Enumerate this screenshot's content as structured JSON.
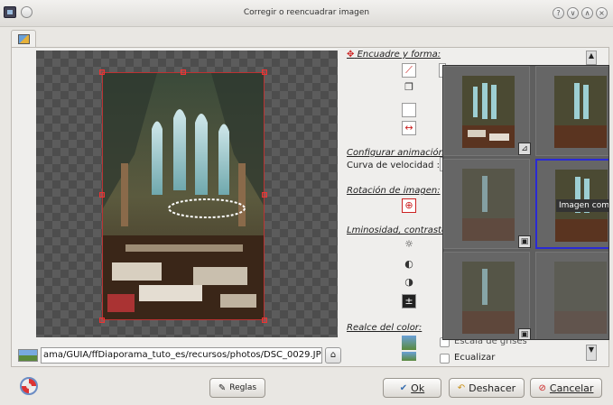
{
  "window": {
    "title": "Corregir o reencuadrar imagen",
    "controls": [
      "?",
      "∨",
      "∧",
      "×"
    ]
  },
  "editor": {
    "file_path": "ama/GUIA/ffDiaporama_tuto_es/recursos/photos/DSC_0029.JPG",
    "open_icon": "folder-open-icon"
  },
  "panel": {
    "sections": {
      "framing": "Encuadre y forma:",
      "animation": "Configurar animación:",
      "speed_curve": "Curva de velocidad :",
      "rotation": "Rotación de imagen:",
      "luminosity": "Lminosidad, contraste",
      "color": "Realce del color:"
    },
    "checkboxes": {
      "grayscale": "Escala de grises",
      "equalize": "Ecualizar"
    }
  },
  "popup": {
    "tooltip": "Imagen com",
    "cells": [
      {
        "id": 1,
        "state": "normal"
      },
      {
        "id": 2,
        "state": "normal"
      },
      {
        "id": 3,
        "state": "faded"
      },
      {
        "id": 4,
        "state": "selected"
      },
      {
        "id": 5,
        "state": "faded"
      },
      {
        "id": 6,
        "state": "dim"
      }
    ]
  },
  "buttons": {
    "rules": "Reglas",
    "ok": "Ok",
    "undo": "Deshacer",
    "cancel": "Cancelar"
  },
  "colors": {
    "accent_selection": "#2a2ad4",
    "crop_handles": "#e33333",
    "checker_dark": "#4d4d4d",
    "checker_light": "#5c5c5c"
  }
}
